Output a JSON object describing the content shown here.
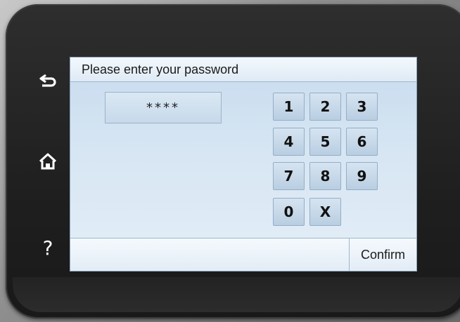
{
  "screen": {
    "title": "Please enter your password",
    "password_mask": "****"
  },
  "side_buttons": {
    "back_icon": "back-arrow-icon",
    "home_icon": "home-icon",
    "help_label": "?"
  },
  "keypad": {
    "keys": [
      "1",
      "2",
      "3",
      "4",
      "5",
      "6",
      "7",
      "8",
      "9",
      "0",
      "X"
    ]
  },
  "footer": {
    "confirm_label": "Confirm"
  }
}
